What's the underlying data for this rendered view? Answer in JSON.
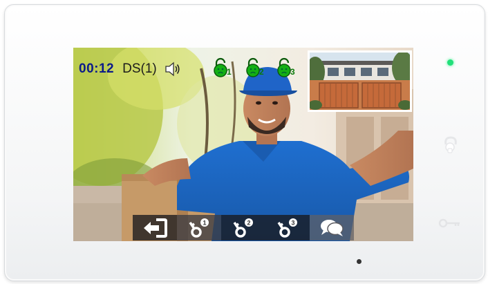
{
  "call_status": {
    "timer": "00:12",
    "door_station": "DS(1)",
    "speaker_icon": "speaker-volume-icon"
  },
  "locks": [
    {
      "icon": "unlock-icon",
      "number": "1",
      "color": "#0fa30f"
    },
    {
      "icon": "unlock-icon",
      "number": "2",
      "color": "#0fa30f"
    },
    {
      "icon": "unlock-icon",
      "number": "3",
      "color": "#0fa30f"
    }
  ],
  "toolbar": {
    "buttons": [
      {
        "icon": "exit-icon"
      },
      {
        "icon": "unlock-1-icon",
        "number": "1"
      },
      {
        "icon": "unlock-2-icon",
        "number": "2"
      },
      {
        "icon": "unlock-3-icon",
        "number": "3"
      },
      {
        "icon": "talk-icon"
      }
    ]
  },
  "panel": {
    "led_color": "#22e07a",
    "hardware_buttons": [
      "talk-icon",
      "key-icon"
    ]
  }
}
